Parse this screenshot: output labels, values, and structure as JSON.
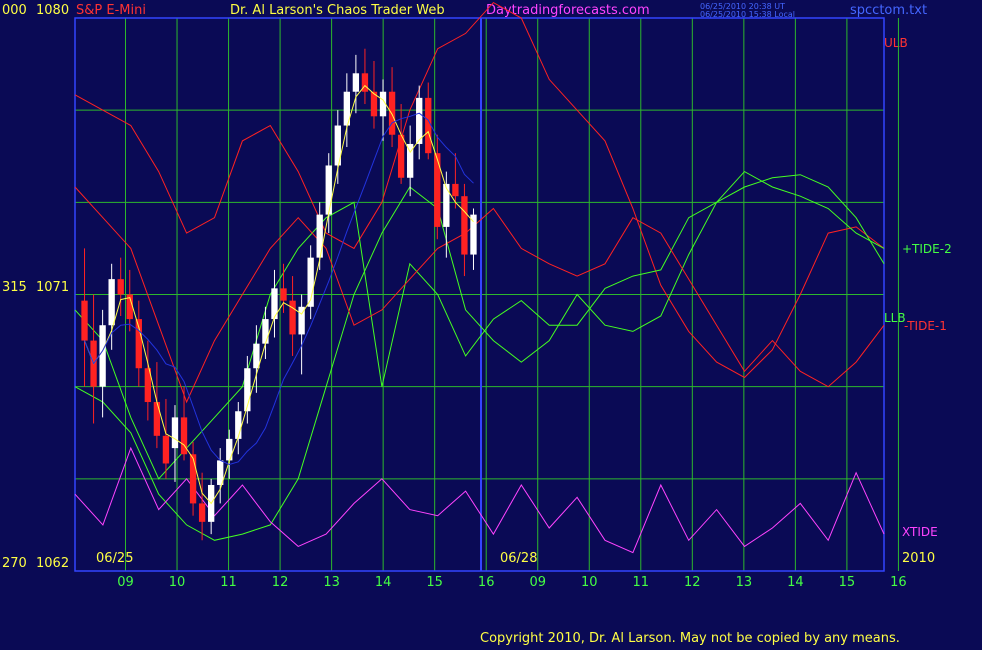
{
  "header": {
    "symbol": "S&P E-Mini",
    "title": "Dr. Al Larson's Chaos Trader Web",
    "site": "Daytradingforecasts.com",
    "stamp1": "06/25/2010 20:38 UT",
    "stamp2": "06/25/2010 15:38 Local",
    "file": "spcctom.txt"
  },
  "footer": {
    "copyright": "Copyright 2010, Dr. Al Larson. May not be copied by any means."
  },
  "colors": {
    "bg": "#0a0a55",
    "grid": "#2db82d",
    "axis": "#3344ff",
    "red": "#ff2222",
    "green": "#44ff22",
    "magenta": "#ff44ff",
    "yellow": "#ffff44",
    "blue": "#2233dd",
    "white": "#ffffff"
  },
  "chart_data": {
    "type": "line",
    "y_left_labels": [
      {
        "angle": "000",
        "price": "1080"
      },
      {
        "angle": "315",
        "price": "1071"
      },
      {
        "angle": "270",
        "price": "1062"
      }
    ],
    "ylim": [
      1062,
      1080
    ],
    "x_ticks": [
      "09",
      "10",
      "11",
      "12",
      "13",
      "14",
      "15",
      "16",
      "09",
      "10",
      "11",
      "12",
      "13",
      "14",
      "15",
      "16"
    ],
    "date_labels": [
      "06/25",
      "06/28"
    ],
    "year_label": "2010",
    "legend": [
      {
        "name": "ULB",
        "color": "#ff2222"
      },
      {
        "name": "+TIDE-2",
        "color": "#44ff22"
      },
      {
        "name": "LLB",
        "color": "#44ff22"
      },
      {
        "name": "-TIDE-1",
        "color": "#ff2222"
      },
      {
        "name": "XTIDE",
        "color": "#ff44ff"
      }
    ],
    "price_bars": [
      [
        1070.8,
        1072.5,
        1068.0,
        1069.5
      ],
      [
        1069.5,
        1071.0,
        1066.8,
        1068.0
      ],
      [
        1068.0,
        1070.5,
        1067.0,
        1070.0
      ],
      [
        1070.0,
        1072.0,
        1069.2,
        1071.5
      ],
      [
        1071.5,
        1072.2,
        1070.3,
        1071.0
      ],
      [
        1071.0,
        1071.8,
        1069.8,
        1070.2
      ],
      [
        1070.2,
        1070.8,
        1068.0,
        1068.6
      ],
      [
        1068.6,
        1069.5,
        1066.9,
        1067.5
      ],
      [
        1067.5,
        1068.8,
        1066.0,
        1066.4
      ],
      [
        1066.4,
        1067.6,
        1065.0,
        1065.5
      ],
      [
        1066.0,
        1067.4,
        1064.9,
        1067.0
      ],
      [
        1067.0,
        1068.0,
        1065.6,
        1065.8
      ],
      [
        1065.8,
        1066.2,
        1063.8,
        1064.2
      ],
      [
        1064.2,
        1065.2,
        1063.0,
        1063.6
      ],
      [
        1063.6,
        1065.0,
        1063.2,
        1064.8
      ],
      [
        1064.8,
        1066.0,
        1064.2,
        1065.6
      ],
      [
        1065.6,
        1066.6,
        1065.0,
        1066.3
      ],
      [
        1066.3,
        1067.5,
        1065.8,
        1067.2
      ],
      [
        1067.2,
        1069.0,
        1066.8,
        1068.6
      ],
      [
        1068.6,
        1070.0,
        1067.8,
        1069.4
      ],
      [
        1069.4,
        1070.6,
        1068.9,
        1070.2
      ],
      [
        1070.2,
        1071.8,
        1069.6,
        1071.2
      ],
      [
        1071.2,
        1072.0,
        1070.4,
        1070.8
      ],
      [
        1070.8,
        1071.6,
        1069.0,
        1069.7
      ],
      [
        1069.7,
        1071.0,
        1068.4,
        1070.6
      ],
      [
        1070.6,
        1072.6,
        1070.2,
        1072.2
      ],
      [
        1072.2,
        1074.0,
        1071.8,
        1073.6
      ],
      [
        1073.6,
        1075.6,
        1073.0,
        1075.2
      ],
      [
        1075.2,
        1077.0,
        1074.6,
        1076.5
      ],
      [
        1076.5,
        1078.2,
        1075.8,
        1077.6
      ],
      [
        1077.6,
        1078.8,
        1076.9,
        1078.2
      ],
      [
        1078.2,
        1079.0,
        1077.2,
        1077.6
      ],
      [
        1077.6,
        1078.6,
        1076.4,
        1076.8
      ],
      [
        1076.8,
        1078.0,
        1076.0,
        1077.6
      ],
      [
        1077.6,
        1078.4,
        1075.8,
        1076.2
      ],
      [
        1076.2,
        1077.2,
        1074.6,
        1074.8
      ],
      [
        1074.8,
        1076.5,
        1074.2,
        1075.9
      ],
      [
        1075.9,
        1077.8,
        1075.4,
        1077.4
      ],
      [
        1077.4,
        1077.9,
        1075.4,
        1075.6
      ],
      [
        1075.6,
        1076.2,
        1072.8,
        1073.2
      ],
      [
        1073.2,
        1075.0,
        1072.2,
        1074.6
      ],
      [
        1074.6,
        1075.6,
        1073.8,
        1074.2
      ],
      [
        1074.2,
        1074.6,
        1071.6,
        1072.3
      ],
      [
        1072.3,
        1073.8,
        1071.8,
        1073.6
      ]
    ],
    "series": [
      {
        "name": "ULB",
        "color": "#ff2222",
        "y": [
          1077.5,
          1077.0,
          1076.5,
          1075.0,
          1073.0,
          1073.5,
          1076.0,
          1076.5,
          1075.0,
          1073.0,
          1072.5,
          1074.0,
          1077.0,
          1079.0,
          1079.5,
          1080.5,
          1080.0,
          1078.0,
          1077.0,
          1076.0,
          1073.8,
          1071.3,
          1069.8,
          1068.8,
          1068.3,
          1069.2,
          1071.0,
          1073.0,
          1073.2,
          1072.5
        ]
      },
      {
        "name": "LLB",
        "color": "#44ff22",
        "y": [
          1068.0,
          1067.5,
          1066.5,
          1064.5,
          1063.5,
          1063.0,
          1063.2,
          1063.5,
          1065.0,
          1068.0,
          1071.0,
          1073.0,
          1074.5,
          1073.8,
          1070.5,
          1069.5,
          1068.8,
          1069.5,
          1071.0,
          1070.0,
          1069.8,
          1070.3,
          1072.3,
          1074.0,
          1075.0,
          1074.5,
          1074.2,
          1073.8,
          1073.0,
          1072.5
        ]
      },
      {
        "name": "+TIDE-2",
        "color": "#44ff22",
        "y": [
          1070.5,
          1069.5,
          1067.0,
          1065.0,
          1066.0,
          1067.0,
          1068.0,
          1071.0,
          1072.5,
          1073.5,
          1074.0,
          1068.0,
          1072.0,
          1071.0,
          1069.0,
          1070.2,
          1070.8,
          1070.0,
          1070.0,
          1071.2,
          1071.6,
          1071.8,
          1073.5,
          1074.0,
          1074.5,
          1074.8,
          1074.9,
          1074.5,
          1073.5,
          1072.0
        ]
      },
      {
        "name": "-TIDE-1",
        "color": "#ff2222",
        "y": [
          1074.5,
          1073.5,
          1072.5,
          1070.0,
          1067.5,
          1069.5,
          1071.0,
          1072.5,
          1073.5,
          1072.5,
          1070.0,
          1070.5,
          1071.5,
          1072.5,
          1073.0,
          1073.8,
          1072.5,
          1072.0,
          1071.6,
          1072.0,
          1073.5,
          1073.0,
          1071.5,
          1070.0,
          1068.5,
          1069.5,
          1068.5,
          1068.0,
          1068.8,
          1070.0
        ]
      },
      {
        "name": "XTIDE",
        "color": "#ff44ff",
        "y": [
          1064.5,
          1063.5,
          1066.0,
          1064.0,
          1065.0,
          1063.8,
          1064.8,
          1063.6,
          1062.8,
          1063.2,
          1064.2,
          1065.0,
          1064.0,
          1063.8,
          1064.6,
          1063.2,
          1064.8,
          1063.4,
          1064.4,
          1063.0,
          1062.6,
          1064.8,
          1063.0,
          1064.0,
          1062.8,
          1063.4,
          1064.2,
          1063.0,
          1065.2,
          1063.2
        ]
      }
    ]
  }
}
